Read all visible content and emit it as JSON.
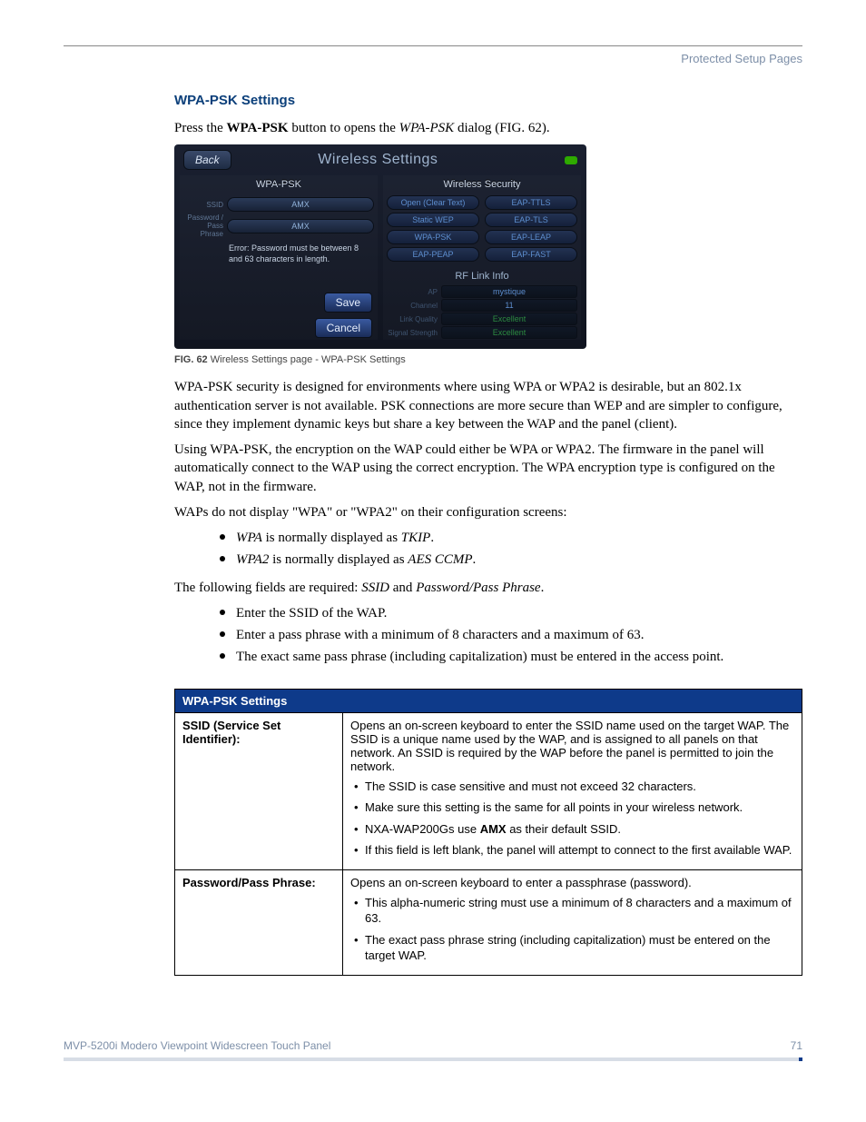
{
  "header": {
    "right": "Protected Setup Pages"
  },
  "section": {
    "title": "WPA-PSK Settings",
    "intro_pre": "Press the ",
    "intro_bold": "WPA-PSK",
    "intro_mid": " button to opens the ",
    "intro_em": "WPA-PSK",
    "intro_post": " dialog (FIG. 62)."
  },
  "figure": {
    "back": "Back",
    "title": "Wireless Settings",
    "left_panel": "WPA-PSK",
    "ssid_label": "SSID",
    "ssid_value": "AMX",
    "pass_label": "Password / Pass Phrase",
    "pass_value": "AMX",
    "error": "Error: Password must be between 8 and 63 characters in length.",
    "save": "Save",
    "cancel": "Cancel",
    "right_panel": "Wireless Security",
    "security": [
      "Open (Clear Text)",
      "EAP-TTLS",
      "Static WEP",
      "EAP-TLS",
      "WPA-PSK",
      "EAP-LEAP",
      "EAP-PEAP",
      "EAP-FAST"
    ],
    "rf_title": "RF Link Info",
    "rf_rows": [
      {
        "k": "AP",
        "v": "mystique",
        "c": "blue"
      },
      {
        "k": "Channel",
        "v": "11",
        "c": "blue"
      },
      {
        "k": "Link Quality",
        "v": "Excellent",
        "c": "green"
      },
      {
        "k": "Signal Strength",
        "v": "Excellent",
        "c": "green"
      }
    ],
    "caption_b": "FIG. 62",
    "caption": "  Wireless Settings page - WPA-PSK Settings"
  },
  "paragraphs": {
    "p1": "WPA-PSK security is designed for environments where using WPA or WPA2 is desirable, but an 802.1x authentication server is not available. PSK connections are more secure than WEP and are simpler to configure, since they implement dynamic keys but share a key between the WAP and the panel (client).",
    "p2": "Using WPA-PSK, the encryption on the WAP could either be WPA or WPA2. The firmware in the panel will automatically connect to the WAP using the correct encryption. The WPA encryption type is configured on the WAP, not in the firmware.",
    "p3": "WAPs do not display \"WPA\" or \"WPA2\" on their configuration screens:"
  },
  "bullets1": {
    "b1_em1": "WPA",
    "b1_mid": " is normally displayed as ",
    "b1_em2": "TKIP",
    "b2_em1": "WPA2",
    "b2_mid": " is normally displayed as ",
    "b2_em2": "AES CCMP"
  },
  "p4": {
    "pre": "The following fields are required: ",
    "em1": "SSID",
    "mid": " and ",
    "em2": "Password/Pass Phrase",
    "post": "."
  },
  "bullets2": [
    "Enter the SSID of the WAP.",
    "Enter a pass phrase with a minimum of 8 characters and a maximum of 63.",
    "The exact same pass phrase (including capitalization) must be entered in the access point."
  ],
  "table": {
    "header": "WPA-PSK Settings",
    "rows": [
      {
        "key": "SSID (Service Set Identifier):",
        "intro": "Opens an on-screen keyboard to enter the SSID name used on the target WAP. The SSID is a unique name used by the WAP, and is assigned to all panels on that network. An SSID is required by the WAP before the panel is permitted to join the network.",
        "points": [
          "The SSID is case sensitive and must not exceed 32 characters.",
          "Make sure this setting is the same for all points in your wireless network.",
          "NXA-WAP200Gs use <b>AMX</b> as their default SSID.",
          "If this field is left blank, the panel will attempt to connect to the first available WAP."
        ]
      },
      {
        "key": "Password/Pass Phrase:",
        "intro": "Opens an on-screen keyboard to enter a passphrase (password).",
        "points": [
          "This alpha-numeric string must use a minimum of 8 characters and a maximum of 63.",
          "The exact pass phrase string (including capitalization) must be entered on the target WAP."
        ]
      }
    ]
  },
  "footer": {
    "left": "MVP-5200i Modero Viewpoint Widescreen Touch Panel",
    "right": "71"
  }
}
